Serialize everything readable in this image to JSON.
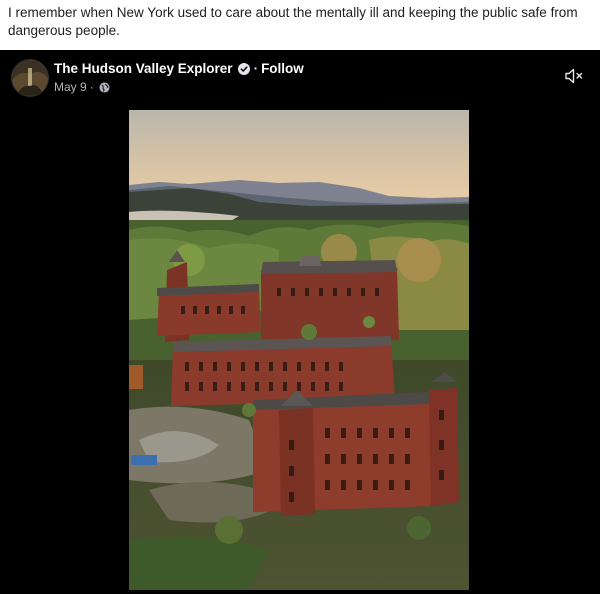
{
  "caption": {
    "text": "I remember when New York used to care about the mentally ill and keeping the public safe from dangerous people."
  },
  "post": {
    "page_name": "The Hudson Valley Explorer",
    "separator": "·",
    "follow_label": "Follow",
    "date": "May 9",
    "date_separator": "·",
    "privacy_icon": "globe-icon",
    "verified_icon": "verified-badge-icon",
    "mute_icon": "speaker-muted-icon"
  },
  "colors": {
    "post_background": "#000000",
    "page_background": "#ffffff",
    "name_text": "#ffffff",
    "meta_text": "#b0b3b8",
    "brick": "#8a3a2a"
  }
}
